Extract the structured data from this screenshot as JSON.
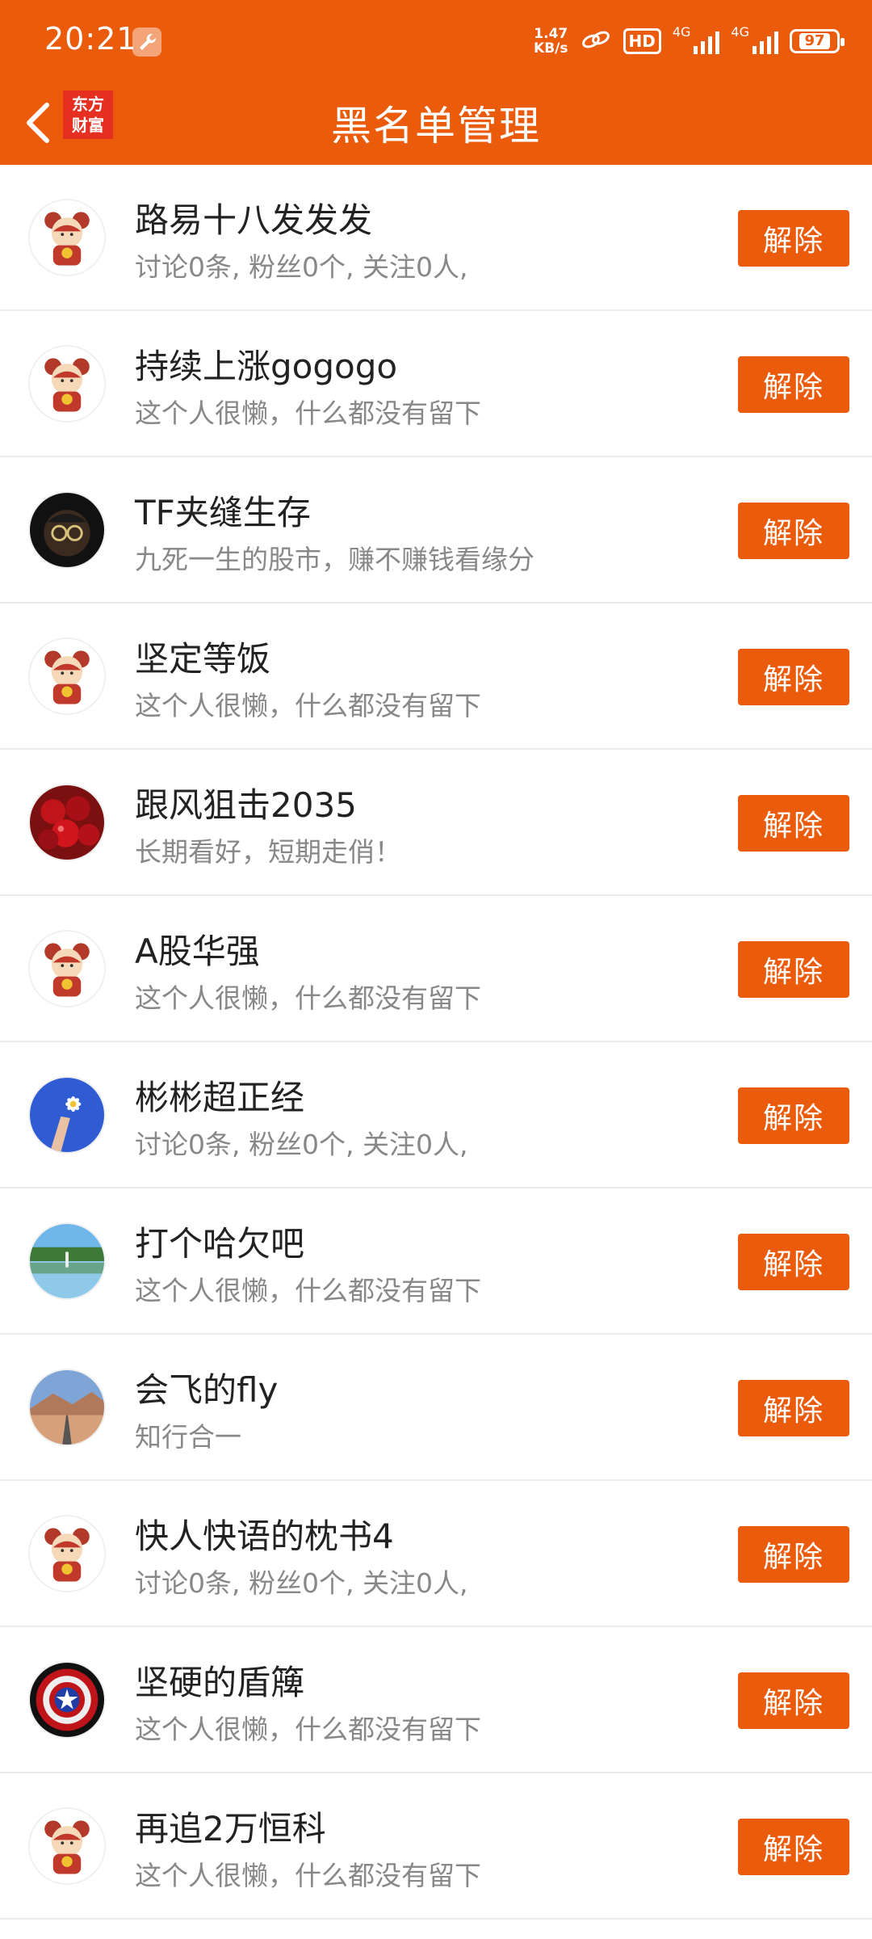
{
  "status": {
    "time": "20:21",
    "net_speed_value": "1.47",
    "net_speed_unit": "KB/s",
    "hd_label": "HD",
    "signal1_label": "4G",
    "signal2_label": "4G",
    "battery": "97"
  },
  "header": {
    "back_icon": "chevron-left-icon",
    "logo_line1": "东方",
    "logo_line2": "财富",
    "title": "黑名单管理"
  },
  "colors": {
    "accent": "#ea5b0c",
    "logo_red": "#e53021"
  },
  "users": [
    {
      "name": "路易十八发发发",
      "desc": "讨论0条, 粉丝0个, 关注0人,",
      "avatar": "default",
      "button": "解除"
    },
    {
      "name": "持续上涨gogogo",
      "desc": "这个人很懒，什么都没有留下",
      "avatar": "default",
      "button": "解除"
    },
    {
      "name": "TF夹缝生存",
      "desc": "九死一生的股市，赚不赚钱看缘分",
      "avatar": "dark-person",
      "button": "解除"
    },
    {
      "name": "坚定等饭",
      "desc": "这个人很懒，什么都没有留下",
      "avatar": "default",
      "button": "解除"
    },
    {
      "name": "跟风狙击2035",
      "desc": "长期看好，短期走俏！",
      "avatar": "cherries",
      "button": "解除"
    },
    {
      "name": "A股华强",
      "desc": "这个人很懒，什么都没有留下",
      "avatar": "default",
      "button": "解除"
    },
    {
      "name": "彬彬超正经",
      "desc": "讨论0条, 粉丝0个, 关注0人,",
      "avatar": "blue-flower",
      "button": "解除"
    },
    {
      "name": "打个哈欠吧",
      "desc": "这个人很懒，什么都没有留下",
      "avatar": "lake",
      "button": "解除"
    },
    {
      "name": "会飞的fly",
      "desc": "知行合一",
      "avatar": "road",
      "button": "解除"
    },
    {
      "name": "快人快语的枕书4",
      "desc": "讨论0条, 粉丝0个, 关注0人,",
      "avatar": "default",
      "button": "解除"
    },
    {
      "name": "坚硬的盾簰",
      "desc": "这个人很懒，什么都没有留下",
      "avatar": "shield",
      "button": "解除"
    },
    {
      "name": "再追2万恒科",
      "desc": "这个人很懒，什么都没有留下",
      "avatar": "default",
      "button": "解除"
    }
  ]
}
